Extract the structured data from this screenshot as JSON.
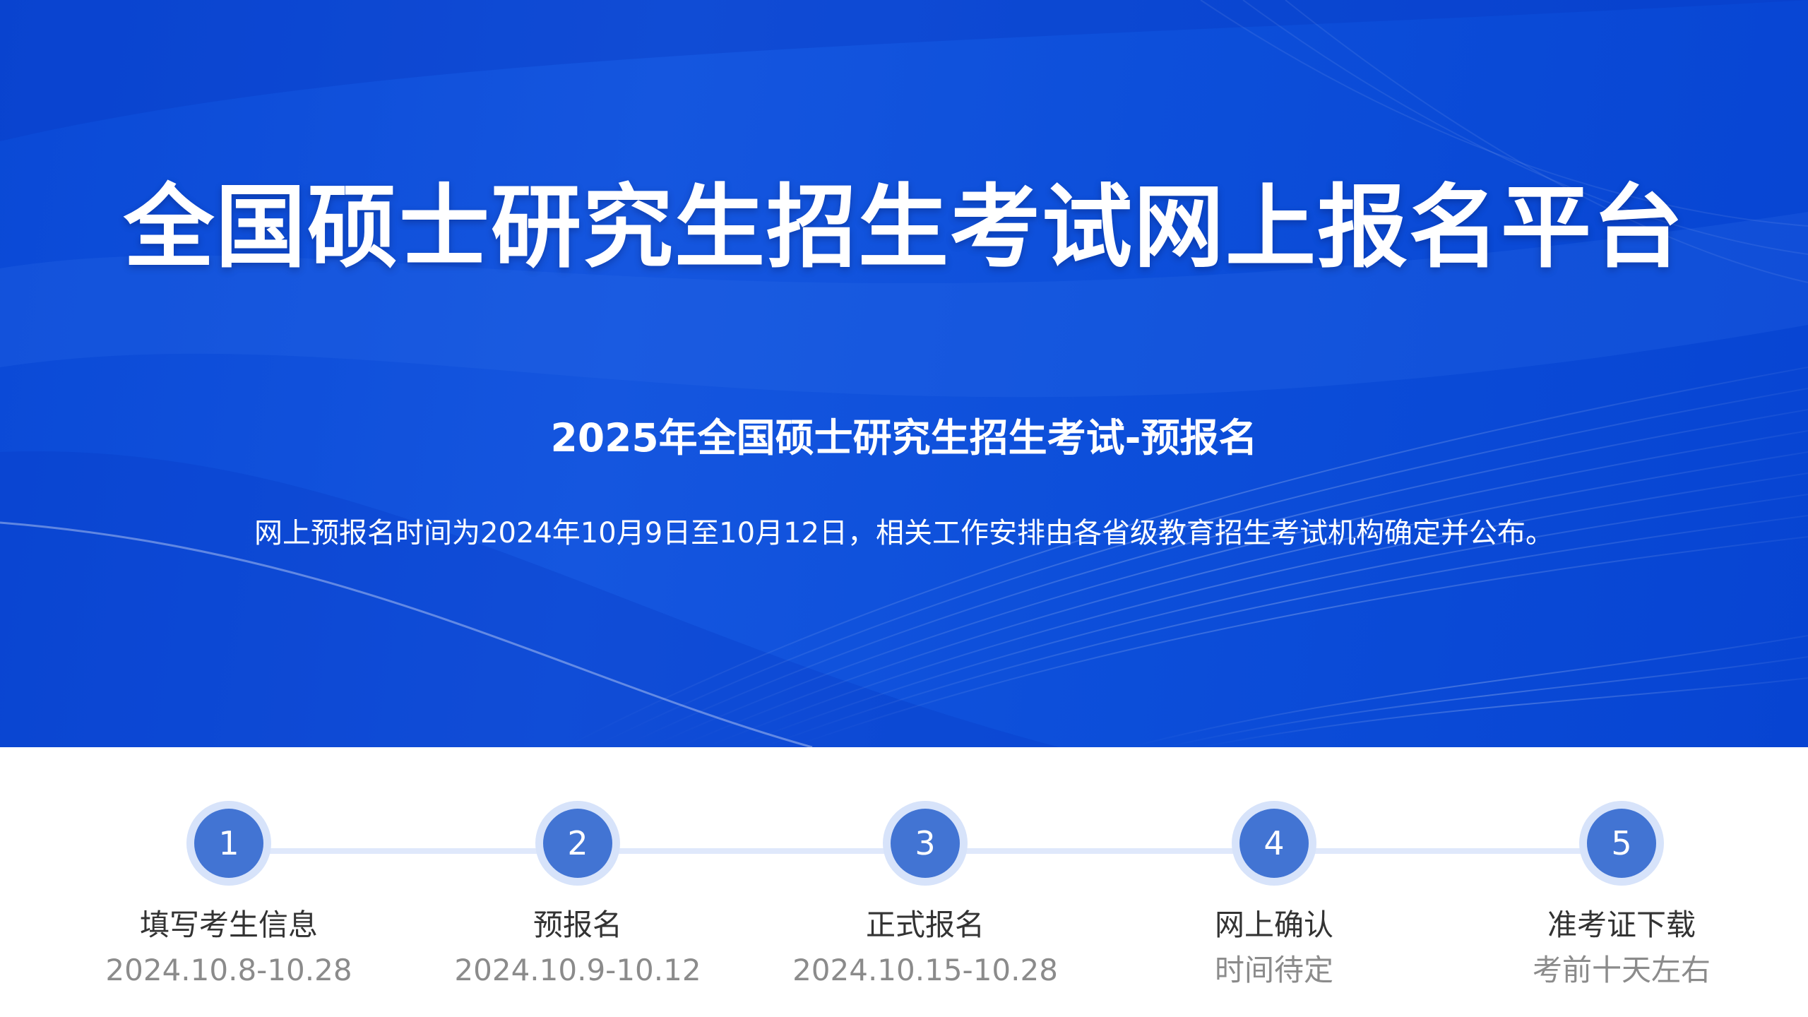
{
  "banner": {
    "title": "全国硕士研究生招生考试网上报名平台",
    "subtitle": "2025年全国硕士研究生招生考试-预报名",
    "notice": "网上预报名时间为2024年10月9日至10月12日，相关工作安排由各省级教育招生考试机构确定并公布。"
  },
  "steps": [
    {
      "number": "1",
      "name": "填写考生信息",
      "date": "2024.10.8-10.28"
    },
    {
      "number": "2",
      "name": "预报名",
      "date": "2024.10.9-10.12"
    },
    {
      "number": "3",
      "name": "正式报名",
      "date": "2024.10.15-10.28"
    },
    {
      "number": "4",
      "name": "网上确认",
      "date": "时间待定"
    },
    {
      "number": "5",
      "name": "准考证下载",
      "date": "考前十天左右"
    }
  ],
  "colors": {
    "banner_blue": "#0a49d6",
    "step_circle": "#4274d3",
    "step_ring": "#d7e3fa",
    "step_line": "#dfe8fb"
  }
}
